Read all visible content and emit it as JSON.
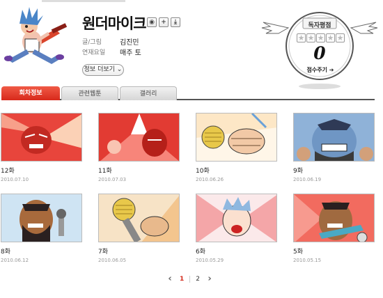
{
  "header": {
    "title": "원더마이크",
    "author_label": "글/그림",
    "author": "김진민",
    "schedule_label": "연재요일",
    "schedule": "매주 토",
    "more_info": "정보 더보기"
  },
  "icons": [
    "rss-icon",
    "plus-icon",
    "download-icon"
  ],
  "rating": {
    "title": "독자평점",
    "score": "0",
    "give_score": "점수주기 ➔"
  },
  "tabs": [
    {
      "label": "회차정보",
      "active": true
    },
    {
      "label": "관련웹툰",
      "active": false
    },
    {
      "label": "갤러리",
      "active": false
    }
  ],
  "episodes": [
    {
      "name": "12화",
      "date": "2010.07.10"
    },
    {
      "name": "11화",
      "date": "2010.07.03"
    },
    {
      "name": "10화",
      "date": "2010.06.26"
    },
    {
      "name": "9화",
      "date": "2010.06.19"
    },
    {
      "name": "8화",
      "date": "2010.06.12"
    },
    {
      "name": "7화",
      "date": "2010.06.05"
    },
    {
      "name": "6화",
      "date": "2010.05.29"
    },
    {
      "name": "5화",
      "date": "2010.05.15"
    }
  ],
  "pagination": {
    "pages": [
      "1",
      "2"
    ],
    "current": "1"
  },
  "colors": {
    "accent": "#d8291b",
    "tab_bg": "#e0e0e0"
  }
}
